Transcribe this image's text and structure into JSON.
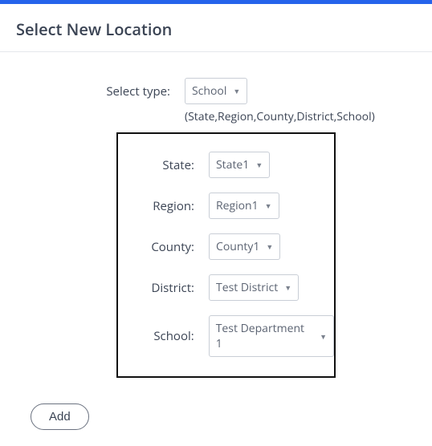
{
  "header": {
    "title": "Select New Location"
  },
  "form": {
    "type": {
      "label": "Select type:",
      "value": "School",
      "hint": "(State,Region,County,District,School)"
    },
    "state": {
      "label": "State:",
      "value": "State1"
    },
    "region": {
      "label": "Region:",
      "value": "Region1"
    },
    "county": {
      "label": "County:",
      "value": "County1"
    },
    "district": {
      "label": "District:",
      "value": "Test District"
    },
    "school": {
      "label": "School:",
      "value": "Test Department 1"
    }
  },
  "actions": {
    "add": "Add"
  }
}
